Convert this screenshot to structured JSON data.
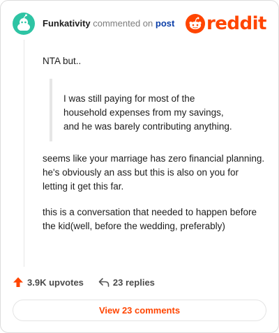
{
  "header": {
    "username": "Funkativity",
    "verb": "commented on",
    "post_link": "post",
    "logo_text": "reddit"
  },
  "comment": {
    "intro": "NTA but..",
    "quote_lines": [
      "I was still paying for most of the",
      "household expenses from my savings,",
      "and he was barely contributing anything."
    ],
    "paragraph_1": "seems like your marriage has zero financial planning. he's obviously an ass but this is also on you for letting it get this far.",
    "paragraph_2": "this is a conversation that needed to happen before the kid(well, before the wedding, preferably)"
  },
  "actions": {
    "upvotes": "3.9K upvotes",
    "replies": "23 replies"
  },
  "footer": {
    "view_comments": "View 23 comments"
  },
  "colors": {
    "brand": "#ff4500",
    "avatar": "#2ec4a4",
    "link": "#0a3ea8"
  },
  "icons": [
    "user-avatar",
    "reddit-logo-icon",
    "upvote-arrow-icon",
    "reply-arrow-icon"
  ]
}
